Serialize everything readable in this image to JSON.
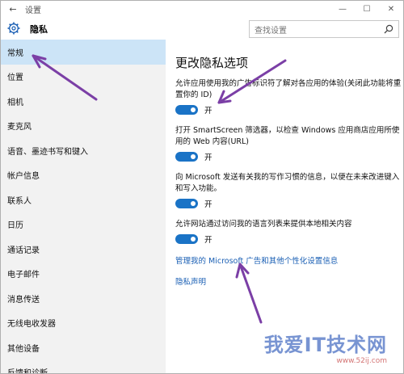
{
  "titlebar": {
    "back": "←",
    "title": "设置",
    "minimize": "—",
    "maximize": "☐",
    "close": "✕"
  },
  "header": {
    "section": "隐私",
    "search_placeholder": "查找设置"
  },
  "sidebar": {
    "items": [
      {
        "label": "常规",
        "active": true
      },
      {
        "label": "位置"
      },
      {
        "label": "相机"
      },
      {
        "label": "麦克风"
      },
      {
        "label": "语音、墨迹书写和键入"
      },
      {
        "label": "帐户信息"
      },
      {
        "label": "联系人"
      },
      {
        "label": "日历"
      },
      {
        "label": "通话记录"
      },
      {
        "label": "电子邮件"
      },
      {
        "label": "消息传送"
      },
      {
        "label": "无线电收发器"
      },
      {
        "label": "其他设备"
      },
      {
        "label": "反馈和诊断"
      }
    ]
  },
  "main": {
    "heading": "更改隐私选项",
    "settings": [
      {
        "text": "允许应用使用我的广告标识符了解对各应用的体验(关闭此功能将重置你的 ID)",
        "state": "开",
        "on": true
      },
      {
        "text": "打开 SmartScreen 筛选器，以检查 Windows 应用商店应用所使用的 Web 内容(URL)",
        "state": "开",
        "on": true
      },
      {
        "text": "向 Microsoft 发送有关我的写作习惯的信息，以便在未来改进键入和写入功能。",
        "state": "开",
        "on": true
      },
      {
        "text": "允许网站通过访问我的语言列表来提供本地相关内容",
        "state": "开",
        "on": true
      }
    ],
    "link_ads": "管理我的 Microsoft 广告和其他个性化设置信息",
    "link_privacy": "隐私声明"
  },
  "watermark": {
    "main": "我爱IT技术网",
    "sub": "www.52ij.com"
  },
  "colors": {
    "accent": "#1a73c6",
    "sidebar_bg": "#f2f2f2",
    "active_bg": "#cce4f7",
    "arrow": "#7b3fa6"
  }
}
